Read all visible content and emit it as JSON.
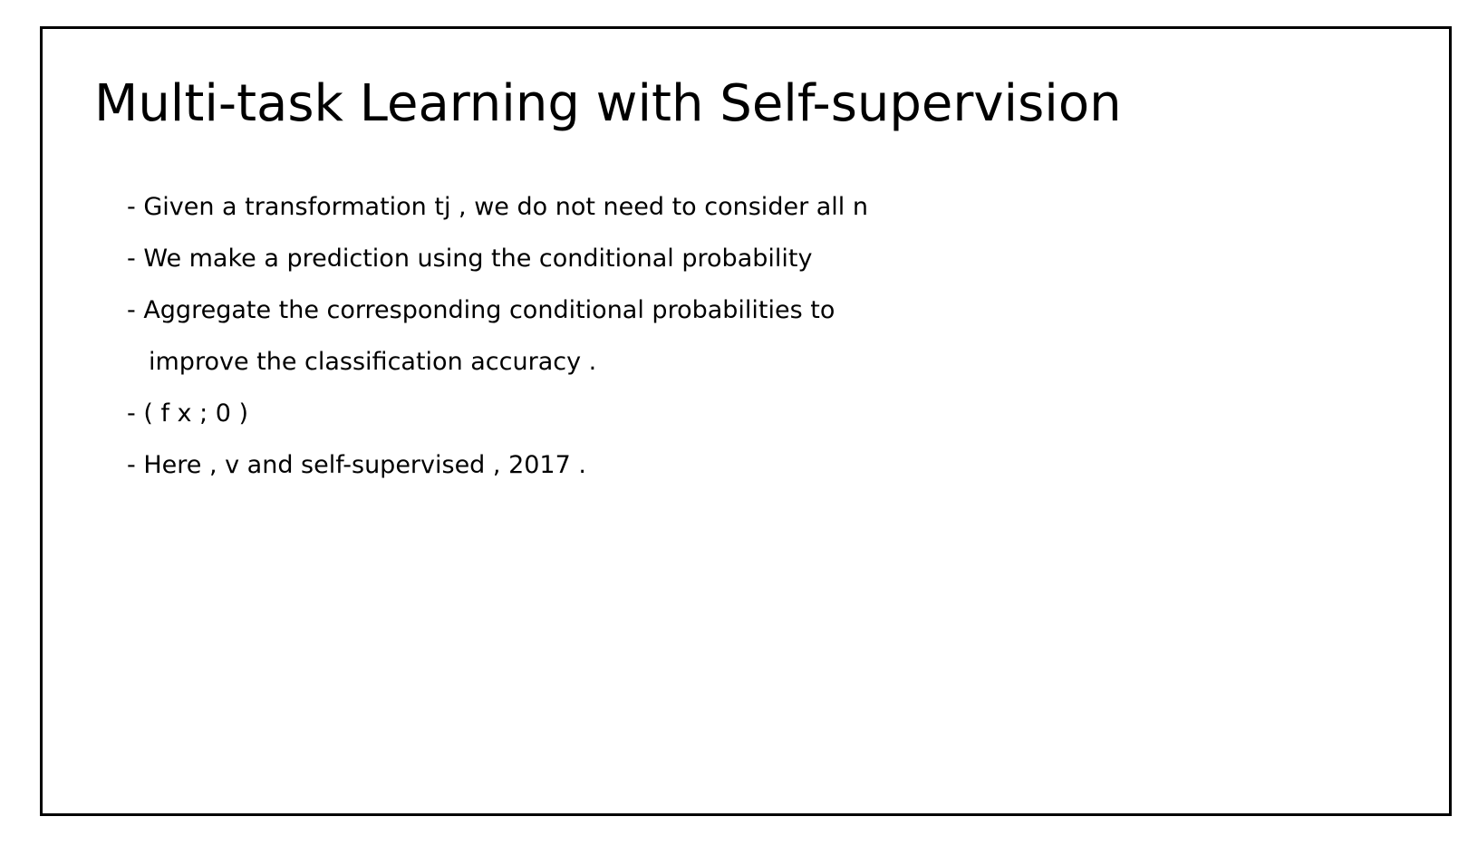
{
  "slide": {
    "title": "Multi-task Learning with Self-supervision",
    "bullets": [
      "- Given a transformation tj , we do not need to consider all n",
      "- We make a prediction using the conditional probability",
      "- Aggregate the corresponding conditional probabilities to",
      "improve the classification accuracy .",
      "- ( f x ; 0 )",
      "- Here , v and self-supervised , 2017 ."
    ]
  }
}
